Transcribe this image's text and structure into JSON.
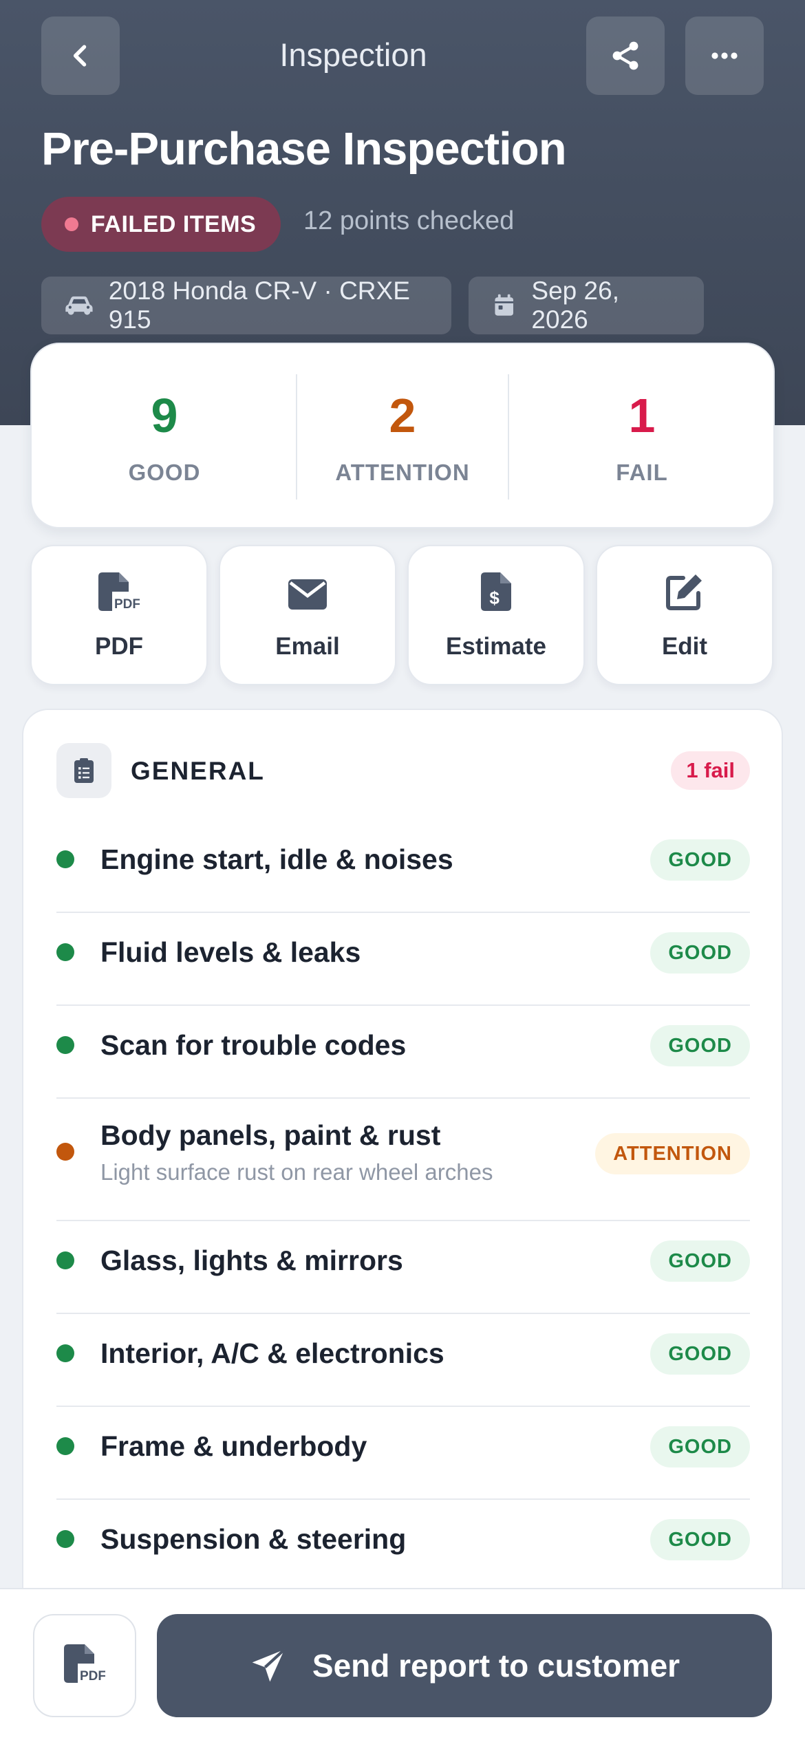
{
  "header": {
    "nav_title": "Inspection",
    "page_title": "Pre-Purchase Inspection",
    "status_label": "FAILED ITEMS",
    "points_checked": "12 points checked",
    "vehicle": "2018 Honda CR-V · CRXE 915",
    "date": "Sep 26, 2026"
  },
  "summary": {
    "good": {
      "count": "9",
      "label": "GOOD"
    },
    "attention": {
      "count": "2",
      "label": "ATTENTION"
    },
    "fail": {
      "count": "1",
      "label": "FAIL"
    }
  },
  "actions": [
    {
      "label": "PDF",
      "icon": "file-pdf-icon"
    },
    {
      "label": "Email",
      "icon": "envelope-icon"
    },
    {
      "label": "Estimate",
      "icon": "file-invoice-dollar-icon"
    },
    {
      "label": "Edit",
      "icon": "edit-icon"
    }
  ],
  "section": {
    "title": "GENERAL",
    "badge": "1 fail",
    "items": [
      {
        "title": "Engine start, idle & noises",
        "note": "",
        "status": "GOOD"
      },
      {
        "title": "Fluid levels & leaks",
        "note": "",
        "status": "GOOD"
      },
      {
        "title": "Scan for trouble codes",
        "note": "",
        "status": "GOOD"
      },
      {
        "title": "Body panels, paint & rust",
        "note": "Light surface rust on rear wheel arches",
        "status": "ATTENTION"
      },
      {
        "title": "Glass, lights & mirrors",
        "note": "",
        "status": "GOOD"
      },
      {
        "title": "Interior, A/C & electronics",
        "note": "",
        "status": "GOOD"
      },
      {
        "title": "Frame & underbody",
        "note": "",
        "status": "GOOD"
      },
      {
        "title": "Suspension & steering",
        "note": "",
        "status": "GOOD"
      }
    ]
  },
  "footer": {
    "send_label": "Send report to customer"
  },
  "colors": {
    "good": "#1d8a49",
    "attention": "#c2570d",
    "fail": "#d81b4b",
    "header_bg": "#4a5568"
  }
}
